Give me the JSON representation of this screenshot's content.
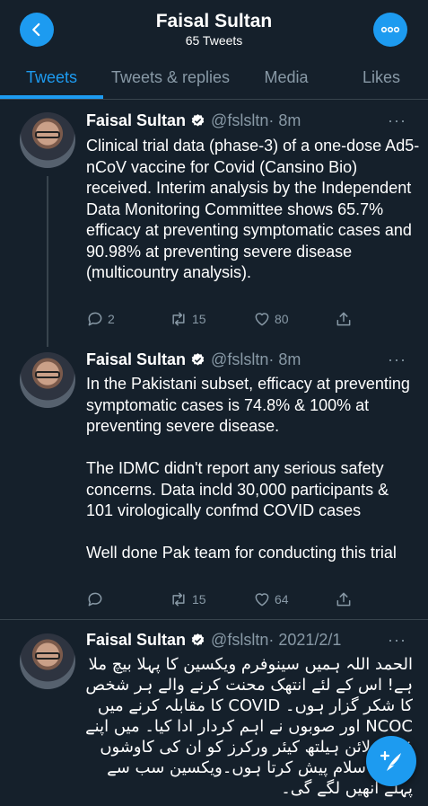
{
  "header": {
    "title": "Faisal Sultan",
    "subtitle": "65 Tweets",
    "back_icon": "chevron-left-icon",
    "more_icon": "more-horizontal-icon",
    "accent": "#1d9bf0"
  },
  "tabs": [
    {
      "label": "Tweets",
      "active": true
    },
    {
      "label": "Tweets & replies",
      "active": false
    },
    {
      "label": "Media",
      "active": false
    },
    {
      "label": "Likes",
      "active": false
    }
  ],
  "tweets": [
    {
      "name": "Faisal Sultan",
      "handle": "@fslsltn",
      "time": "· 8m",
      "more": "···",
      "text": "Clinical trial data (phase-3) of a one-dose Ad5-nCoV vaccine for Covid (Cansino Bio) received. Interim analysis by the Independent Data Monitoring Committee shows 65.7% efficacy at preventing symptomatic cases and 90.98% at preventing severe disease (multicountry analysis).",
      "replies": "2",
      "retweets": "15",
      "likes": "80"
    },
    {
      "name": "Faisal Sultan",
      "handle": "@fslsltn",
      "time": "· 8m",
      "more": "···",
      "text": "In the Pakistani subset, efficacy at preventing symptomatic cases is 74.8% & 100% at preventing severe disease.\n\nThe IDMC didn't report any serious safety concerns. Data incld 30,000 participants & 101 virologically confmd COVID cases\n\nWell done Pak team for conducting this trial",
      "replies": "",
      "retweets": "15",
      "likes": "64"
    },
    {
      "name": "Faisal Sultan",
      "handle": "@fslsltn",
      "time": "· 2021/2/1",
      "more": "···",
      "text": "الحمد اللہ ہمیں سینوفرم ویکسین کا پہلا بیچ ملا ہے! اس کے لئے انتھک محنت کرنے والے ہر شخص کا شکر گزار ہوں۔ COVID کا مقابلہ کرنے میں NCOC اور صوبوں نے اہم کردار ادا کیا۔ میں اپنے فرنٹ لائن ہیلتھ کیئر ورکرز کو ان کی کاوشوں کے لئے سلام پیش کرتا ہوں۔ویکسین سب سے پہلے انھیں لگے گی۔"
    }
  ],
  "compose_icon": "feather-plus-icon"
}
